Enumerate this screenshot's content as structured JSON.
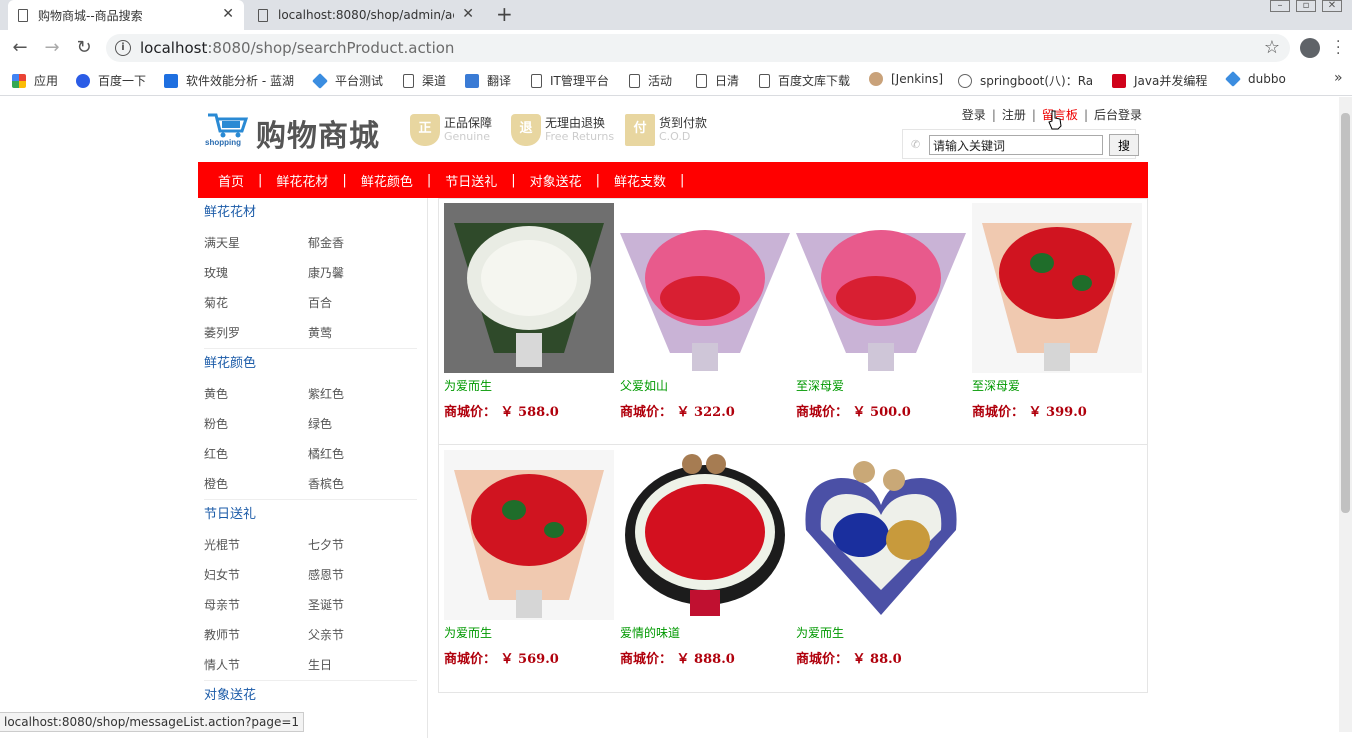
{
  "browser": {
    "tabs": [
      {
        "title": "购物商城--商品搜索",
        "active": true
      },
      {
        "title": "localhost:8080/shop/admin/ac",
        "active": false
      }
    ],
    "url_host": "localhost",
    "url_rest": ":8080/shop/searchProduct.action",
    "bookmarks": [
      "应用",
      "百度一下",
      "软件效能分析 - 蓝湖",
      "平台测试",
      "渠道",
      "翻译",
      "IT管理平台",
      "活动",
      "日清",
      "百度文库下载",
      "[Jenkins]",
      "springboot(八)：Ra",
      "Java并发编程",
      "dubbo"
    ],
    "status_url": "localhost:8080/shop/messageList.action?page=1"
  },
  "header": {
    "logo_text": "购物商城",
    "logo_sub": "shopping",
    "promises": [
      {
        "icon": "正",
        "title": "正品保障",
        "sub": "Genuine"
      },
      {
        "icon": "退",
        "title": "无理由退换",
        "sub": "Free Returns"
      },
      {
        "icon": "付",
        "title": "货到付款",
        "sub": "C.O.D"
      }
    ],
    "links": {
      "login": "登录",
      "register": "注册",
      "guestbook": "留言板",
      "admin": "后台登录"
    },
    "search": {
      "value": "请输入关键词",
      "button": "搜"
    }
  },
  "nav": [
    "首页",
    "鲜花花材",
    "鲜花颜色",
    "节日送礼",
    "对象送花",
    "鲜花支数"
  ],
  "sidebar": [
    {
      "title": "鲜花花材",
      "items": [
        "满天星",
        "郁金香",
        "玫瑰",
        "康乃馨",
        "菊花",
        "百合",
        "萎列罗",
        "黄莺"
      ]
    },
    {
      "title": "鲜花颜色",
      "items": [
        "黄色",
        "紫红色",
        "粉色",
        "绿色",
        "红色",
        "橘红色",
        "橙色",
        "香槟色"
      ]
    },
    {
      "title": "节日送礼",
      "items": [
        "光棍节",
        "七夕节",
        "妇女节",
        "感恩节",
        "母亲节",
        "圣诞节",
        "教师节",
        "父亲节",
        "情人节",
        "生日"
      ]
    },
    {
      "title": "对象送花",
      "items": []
    }
  ],
  "products": [
    {
      "name": "为爱而生",
      "price": "商城价： ￥ 588.0",
      "kind": "white"
    },
    {
      "name": "父爱如山",
      "price": "商城价： ￥ 322.0",
      "kind": "pink"
    },
    {
      "name": "至深母爱",
      "price": "商城价： ￥ 500.0",
      "kind": "pink"
    },
    {
      "name": "至深母爱",
      "price": "商城价： ￥ 399.0",
      "kind": "red"
    },
    {
      "name": "为爱而生",
      "price": "商城价： ￥ 569.0",
      "kind": "red"
    },
    {
      "name": "爱情的味道",
      "price": "商城价： ￥ 888.0",
      "kind": "redbox"
    },
    {
      "name": "为爱而生",
      "price": "商城价： ￥ 88.0",
      "kind": "heart"
    }
  ],
  "colors": {
    "nav": "#ff0000",
    "category": "#1b5ba8",
    "product_name": "#009900",
    "price": "#b0000c"
  }
}
